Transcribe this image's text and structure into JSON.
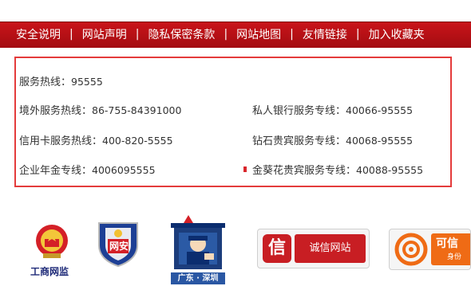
{
  "nav": {
    "items": [
      "安全说明",
      "网站声明",
      "隐私保密条款",
      "网站地图",
      "友情链接",
      "加入收藏夹"
    ],
    "separator": "|"
  },
  "contacts": {
    "hotline_label": "服务热线：",
    "hotline_num": "95555",
    "overseas_label": "境外服务热线：",
    "overseas_num": "86-755-84391000",
    "private_label": "私人银行服务专线：",
    "private_num": "40066-95555",
    "credit_label": "信用卡服务热线：",
    "credit_num": "400-820-5555",
    "diamond_label": "钻石贵宾服务专线：",
    "diamond_num": "40068-95555",
    "pension_label": "企业年金专线：",
    "pension_num": "4006095555",
    "sunflower_label": "金葵花贵宾服务专线：",
    "sunflower_num": "40088-95555"
  },
  "badges": {
    "aic_text": "工商网监",
    "police_text": "网安",
    "region_text": "广东 · 深圳",
    "integrity_icon_char": "信",
    "integrity_text": "诚信网站",
    "trusted_title": "可信",
    "trusted_sub": "身份"
  },
  "colors": {
    "nav_bg": "#b50f15",
    "box_border": "#e43b3b",
    "integrity_red": "#c81e23",
    "trusted_orange": "#ef6b15"
  }
}
